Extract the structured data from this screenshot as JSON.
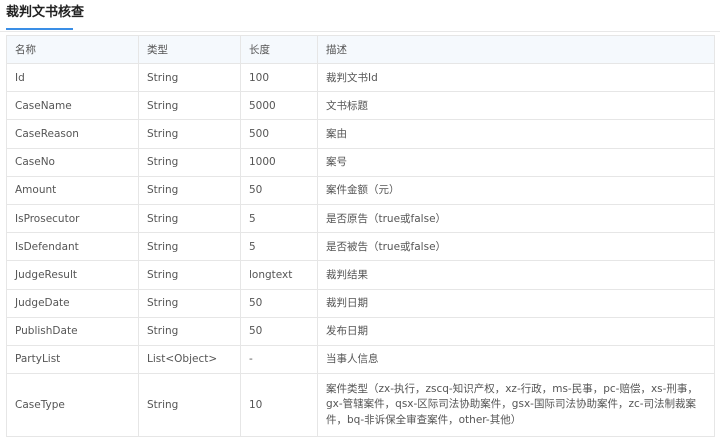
{
  "page": {
    "title": "裁判文书核查"
  },
  "table": {
    "headers": [
      "名称",
      "类型",
      "长度",
      "描述"
    ],
    "rows": [
      [
        "Id",
        "String",
        "100",
        "裁判文书Id"
      ],
      [
        "CaseName",
        "String",
        "5000",
        "文书标题"
      ],
      [
        "CaseReason",
        "String",
        "500",
        "案由"
      ],
      [
        "CaseNo",
        "String",
        "1000",
        "案号"
      ],
      [
        "Amount",
        "String",
        "50",
        "案件金额（元）"
      ],
      [
        "IsProsecutor",
        "String",
        "5",
        "是否原告（true或false）"
      ],
      [
        "IsDefendant",
        "String",
        "5",
        "是否被告（true或false）"
      ],
      [
        "JudgeResult",
        "String",
        "longtext",
        "裁判结果"
      ],
      [
        "JudgeDate",
        "String",
        "50",
        "裁判日期"
      ],
      [
        "PublishDate",
        "String",
        "50",
        "发布日期"
      ],
      [
        "PartyList",
        "List<Object>",
        "-",
        "当事人信息"
      ],
      [
        "CaseType",
        "String",
        "10",
        "案件类型（zx-执行，zscq-知识产权，xz-行政，ms-民事，pc-赔偿，xs-刑事，gx-管辖案件，qsx-区际司法协助案件，gsx-国际司法协助案件，zc-司法制裁案件，bq-非诉保全审查案件，other-其他）"
      ]
    ]
  }
}
